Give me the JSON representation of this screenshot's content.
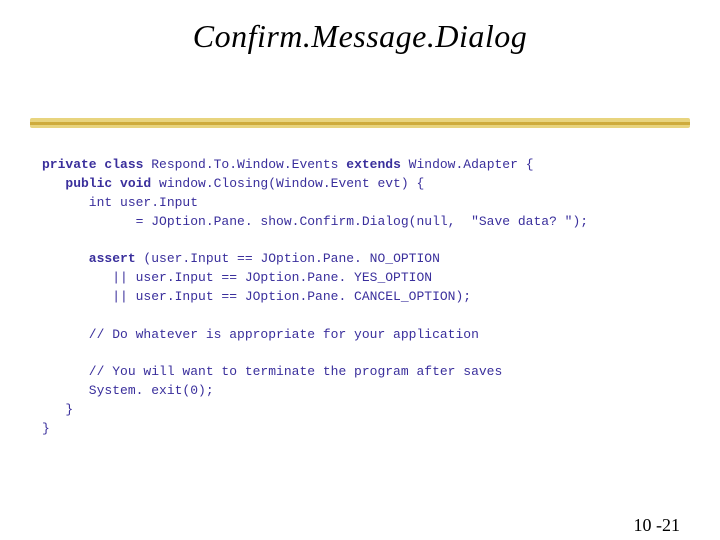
{
  "title": "Confirm.Message.Dialog",
  "page_number": "10 -21",
  "code": {
    "l1a": "private class",
    "l1b": " Respond.To.Window.Events ",
    "l1c": "extends",
    "l1d": " Window.Adapter {",
    "l2a": "   public void",
    "l2b": " window.Closing(Window.Event evt) {",
    "l3": "      int user.Input",
    "l4": "            = JOption.Pane. show.Confirm.Dialog(null,  \"Save data? \");",
    "l5a": "      assert",
    "l5b": " (user.Input == JOption.Pane. NO_OPTION",
    "l6": "         || user.Input == JOption.Pane. YES_OPTION",
    "l7": "         || user.Input == JOption.Pane. CANCEL_OPTION);",
    "l8": "      // Do whatever is appropriate for your application",
    "l9": "      // You will want to terminate the program after saves",
    "l10": "      System. exit(0);",
    "l11": "   }",
    "l12": "}"
  }
}
